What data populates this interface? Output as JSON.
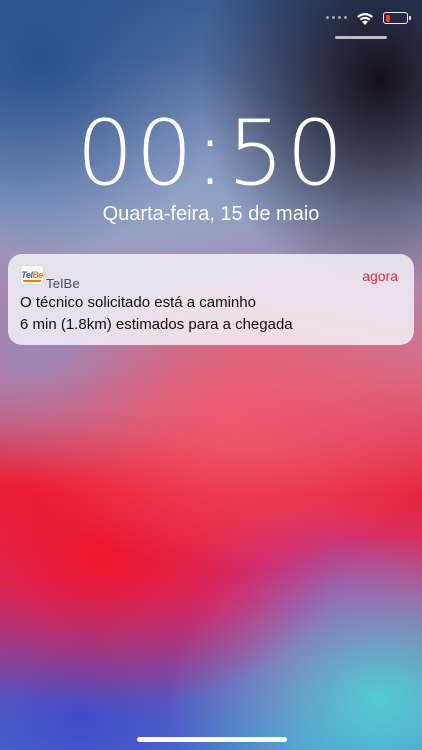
{
  "lock_screen": {
    "time": "00:50",
    "date": "Quarta-feira, 15 de maio"
  },
  "status_bar": {
    "wifi_icon": "wifi-icon",
    "battery_icon": "battery-low-icon",
    "battery_color": "#ff3b30"
  },
  "notification": {
    "app_name": "TelBe",
    "app_icon": {
      "tel": "Tel",
      "be": "Be"
    },
    "time": "agora",
    "title": "O técnico solicitado está a caminho",
    "body": "6 min (1.8km) estimados para a chegada",
    "time_color": "#d8323c"
  }
}
